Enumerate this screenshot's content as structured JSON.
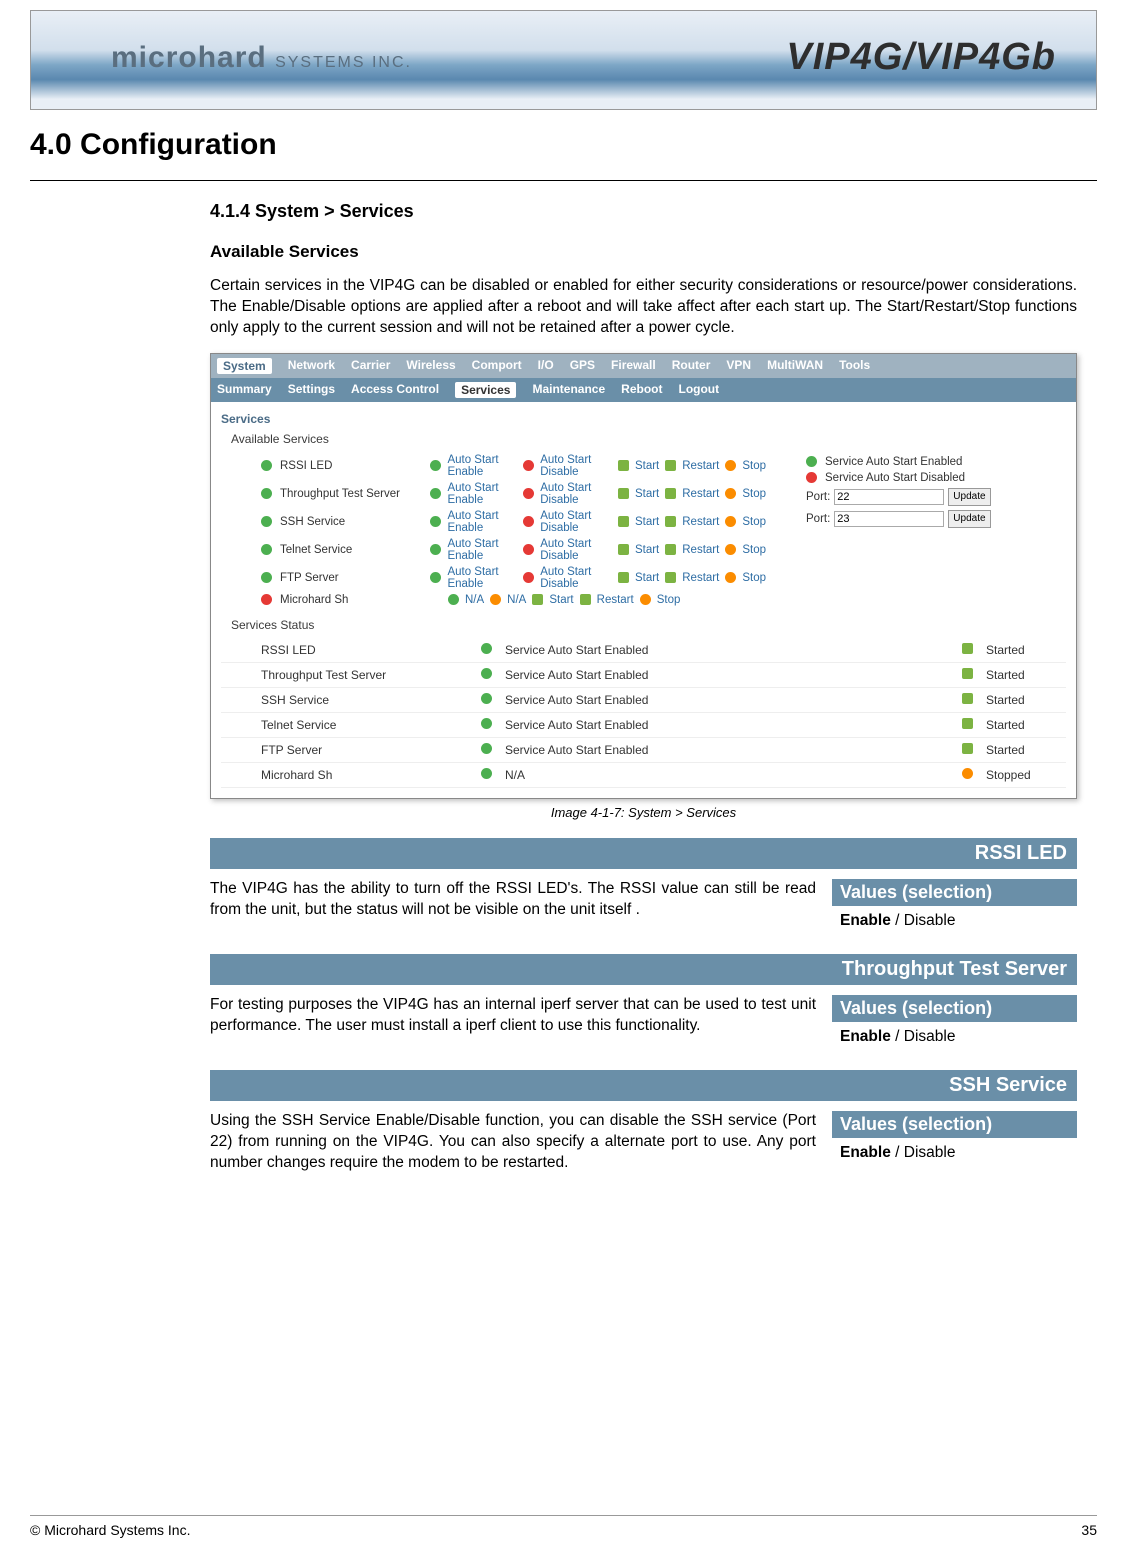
{
  "banner": {
    "logo_main": "microhard",
    "logo_sub": "SYSTEMS INC.",
    "product": "VIP4G/VIP4Gb"
  },
  "title": "4.0  Configuration",
  "section_title": "4.1.4  System > Services",
  "section_sub": "Available Services",
  "intro": "Certain services in the VIP4G can be disabled or enabled for either security considerations or resource/power considerations. The Enable/Disable options are applied after a reboot and will take affect after each start up. The Start/Restart/Stop functions only apply to the current session and will not be retained after a power cycle.",
  "shot": {
    "tabs1": [
      "System",
      "Network",
      "Carrier",
      "Wireless",
      "Comport",
      "I/O",
      "GPS",
      "Firewall",
      "Router",
      "VPN",
      "MultiWAN",
      "Tools"
    ],
    "tabs1_active": "System",
    "tabs2": [
      "Summary",
      "Settings",
      "Access Control",
      "Services",
      "Maintenance",
      "Reboot",
      "Logout"
    ],
    "tabs2_active": "Services",
    "panel_title": "Services",
    "available_title": "Available Services",
    "services": [
      {
        "ok": true,
        "name": "RSSI LED",
        "ase": "Auto Start Enable",
        "asd": "Auto Start Disable",
        "na": false
      },
      {
        "ok": true,
        "name": "Throughput Test Server",
        "ase": "Auto Start Enable",
        "asd": "Auto Start Disable",
        "na": false
      },
      {
        "ok": true,
        "name": "SSH Service",
        "ase": "Auto Start Enable",
        "asd": "Auto Start Disable",
        "na": false
      },
      {
        "ok": true,
        "name": "Telnet Service",
        "ase": "Auto Start Enable",
        "asd": "Auto Start Disable",
        "na": false
      },
      {
        "ok": true,
        "name": "FTP Server",
        "ase": "Auto Start Enable",
        "asd": "Auto Start Disable",
        "na": false
      },
      {
        "ok": false,
        "name": "Microhard Sh",
        "ase": "N/A",
        "asd": "N/A",
        "na": true
      }
    ],
    "actions": {
      "start": "Start",
      "restart": "Restart",
      "stop": "Stop"
    },
    "legend": {
      "enabled": "Service Auto Start Enabled",
      "disabled": "Service Auto Start Disabled"
    },
    "ports": [
      {
        "label": "Port:",
        "value": "22",
        "btn": "Update"
      },
      {
        "label": "Port:",
        "value": "23",
        "btn": "Update"
      }
    ],
    "status_title": "Services Status",
    "status": [
      {
        "name": "RSSI LED",
        "stat": "Service Auto Start Enabled",
        "ok": true,
        "state": "Started"
      },
      {
        "name": "Throughput Test Server",
        "stat": "Service Auto Start Enabled",
        "ok": true,
        "state": "Started"
      },
      {
        "name": "SSH Service",
        "stat": "Service Auto Start Enabled",
        "ok": true,
        "state": "Started"
      },
      {
        "name": "Telnet Service",
        "stat": "Service Auto Start Enabled",
        "ok": true,
        "state": "Started"
      },
      {
        "name": "FTP Server",
        "stat": "Service Auto Start Enabled",
        "ok": true,
        "state": "Started"
      },
      {
        "name": "Microhard Sh",
        "stat": "N/A",
        "ok": true,
        "state": "Stopped"
      }
    ]
  },
  "caption": "Image 4-1-7:  System > Services",
  "sections": [
    {
      "header": "RSSI LED",
      "desc": "The VIP4G has the ability to turn off the RSSI LED's. The RSSI value can still be read from the unit, but the status will not be visible on the unit itself .",
      "vhead": "Values (selection)",
      "vbold": "Enable",
      "vrest": " / Disable"
    },
    {
      "header": "Throughput Test Server",
      "desc": "For testing purposes the VIP4G has an internal iperf server that can be used to test unit performance. The user must install a iperf client to use this functionality.",
      "vhead": "Values (selection)",
      "vbold": "Enable",
      "vrest": " / Disable"
    },
    {
      "header": "SSH Service",
      "desc": "Using the SSH Service Enable/Disable function, you can disable the SSH service (Port 22) from running on the VIP4G. You can also specify a alternate port to use. Any port number changes require the modem to be restarted.",
      "vhead": "Values (selection)",
      "vbold": "Enable",
      "vrest": " / Disable"
    }
  ],
  "footer": {
    "copy": "© Microhard Systems Inc.",
    "page": "35"
  }
}
